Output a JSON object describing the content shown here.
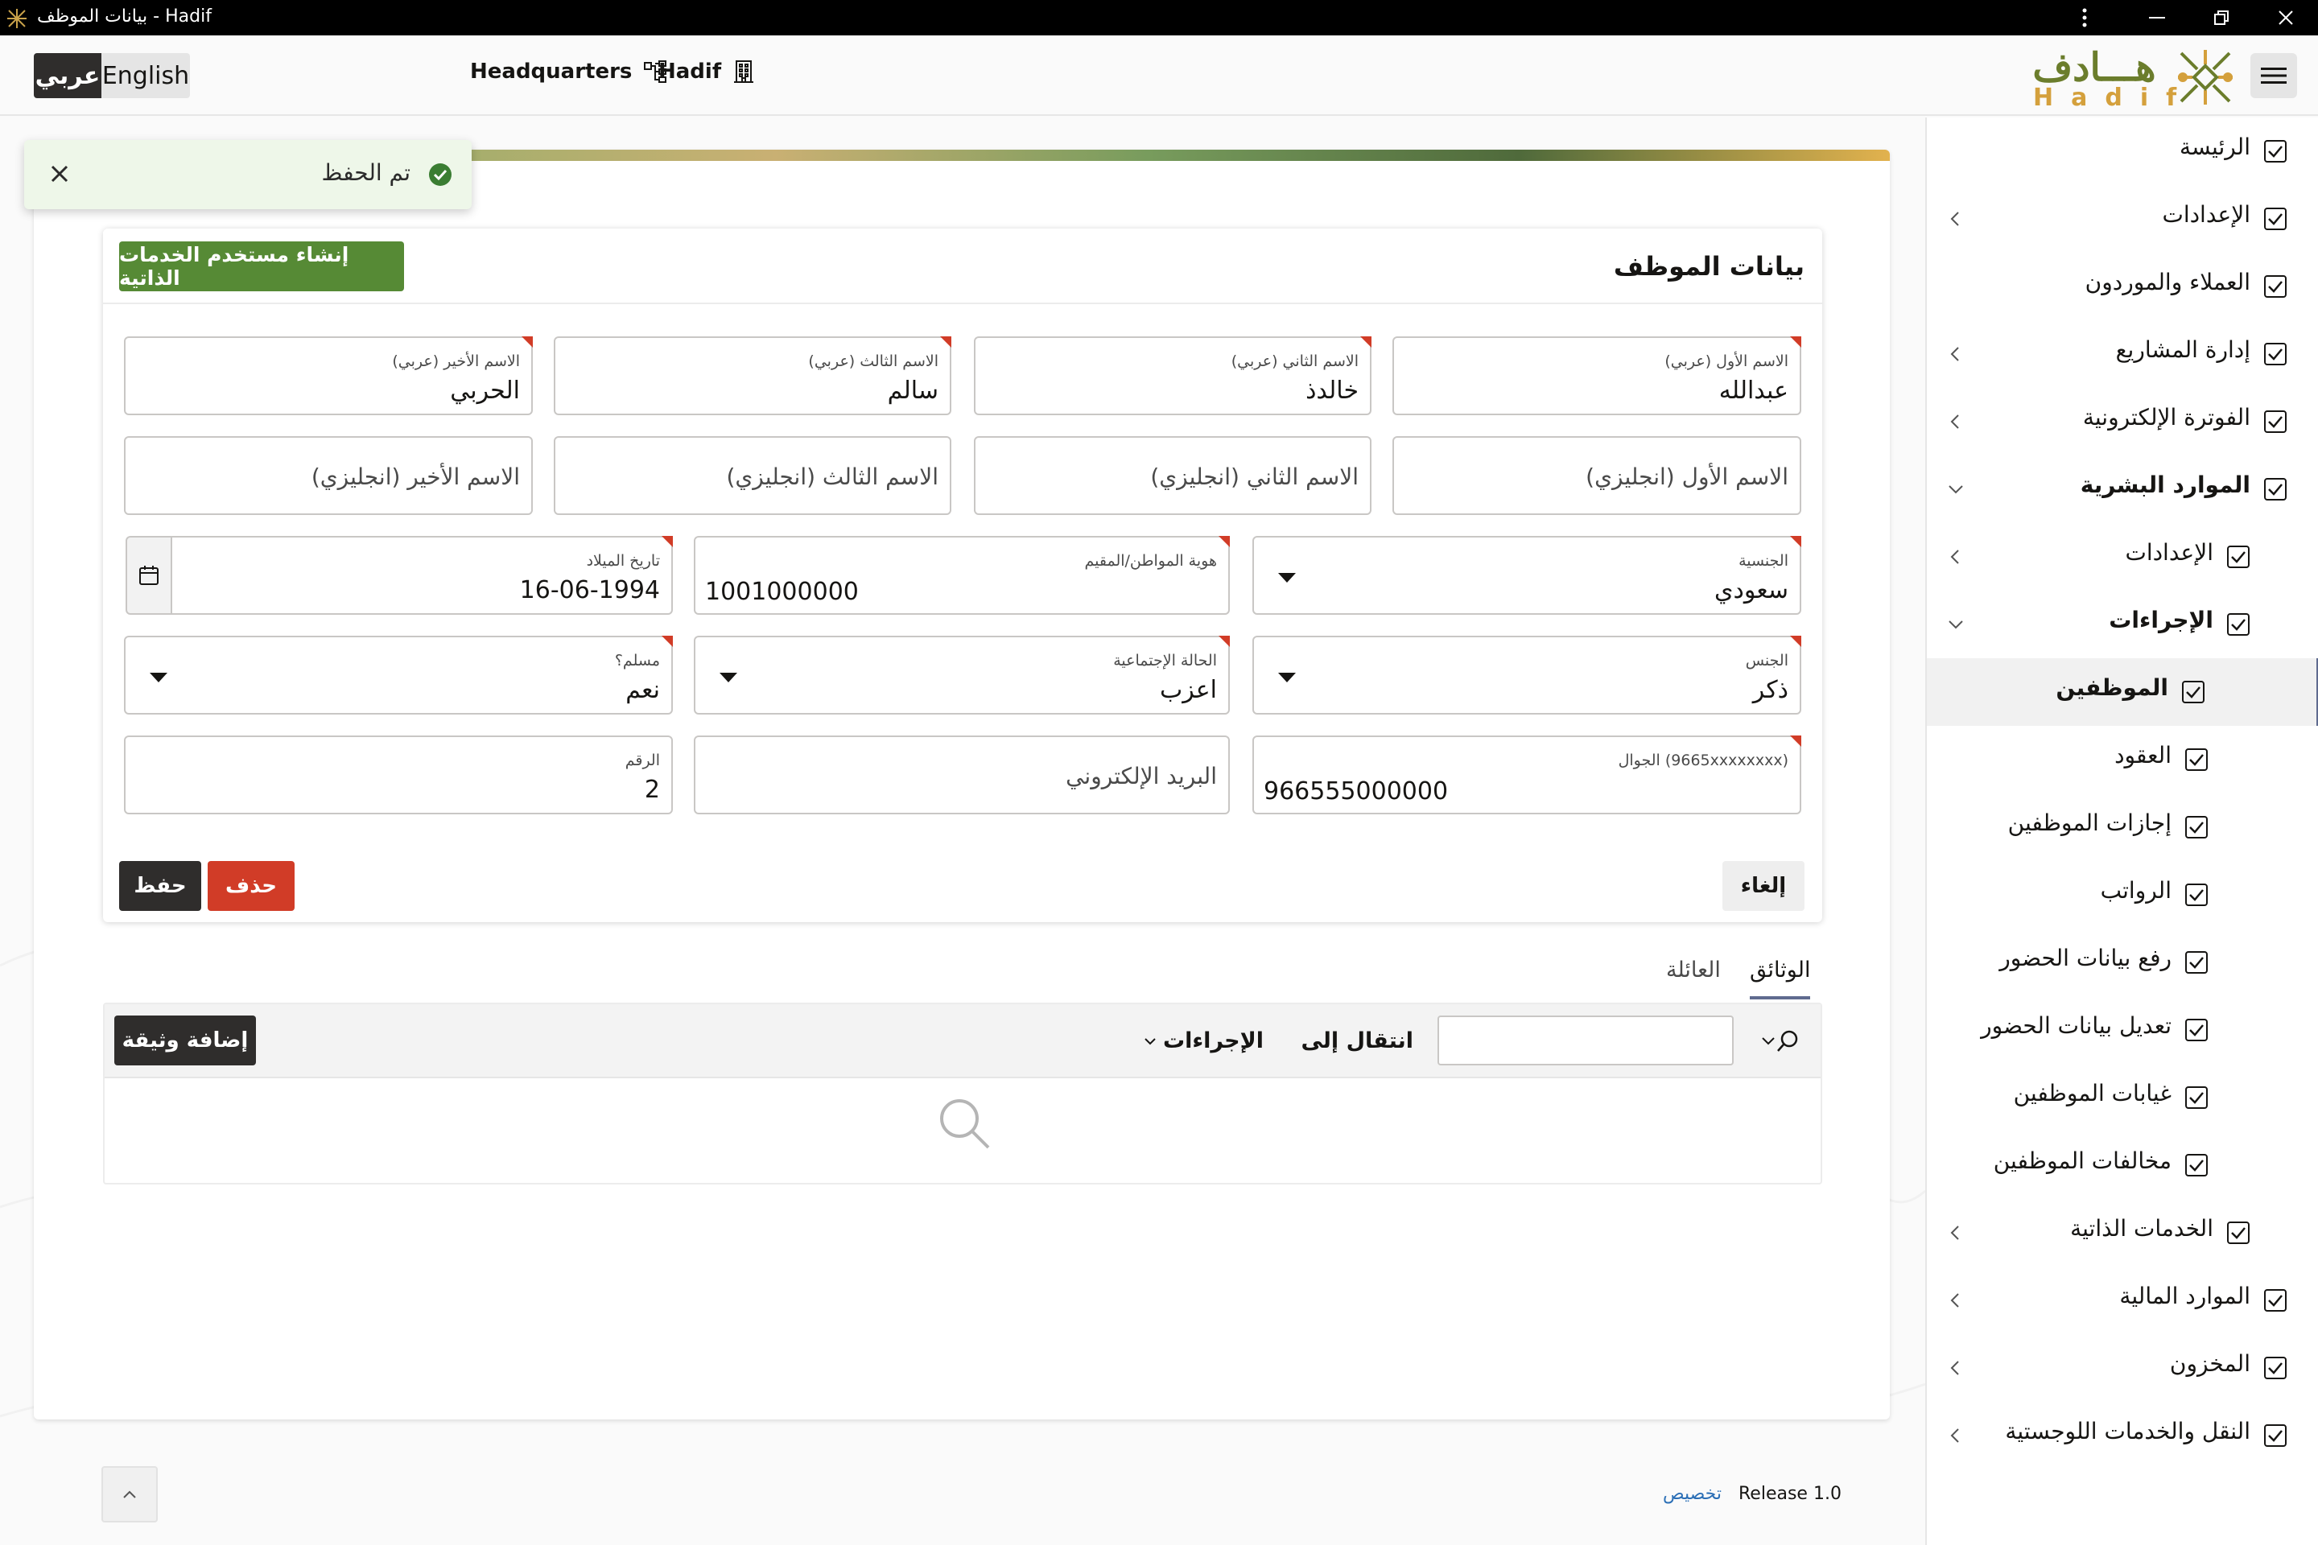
{
  "window": {
    "title": "بيانات الموظف - Hadif"
  },
  "header": {
    "lang_ar": "عربي",
    "lang_en": "English",
    "branch": "Headquarters",
    "company": "Hadif",
    "logo_ar": "هـــادف",
    "logo_en": "Hadif"
  },
  "toast": {
    "message": "تم الحفظ"
  },
  "sidebar": {
    "items": [
      {
        "label": "الرئيسة",
        "bold": false,
        "level": 0,
        "chevron": ""
      },
      {
        "label": "الإعدادات",
        "bold": false,
        "level": 0,
        "chevron": "left"
      },
      {
        "label": "العملاء والموردون",
        "bold": false,
        "level": 0,
        "chevron": ""
      },
      {
        "label": "إدارة المشاريع",
        "bold": false,
        "level": 0,
        "chevron": "left"
      },
      {
        "label": "الفوترة الإلكترونية",
        "bold": false,
        "level": 0,
        "chevron": "left"
      },
      {
        "label": "الموارد البشرية",
        "bold": true,
        "level": 0,
        "chevron": "down"
      },
      {
        "label": "الإعدادات",
        "bold": false,
        "level": 1,
        "chevron": "left"
      },
      {
        "label": "الإجراءات",
        "bold": true,
        "level": 1,
        "chevron": "down"
      },
      {
        "label": "الموظفين",
        "bold": true,
        "level": 2,
        "chevron": "",
        "active": true
      },
      {
        "label": "العقود",
        "bold": false,
        "level": 2,
        "chevron": ""
      },
      {
        "label": "إجازات الموظفين",
        "bold": false,
        "level": 2,
        "chevron": ""
      },
      {
        "label": "الرواتب",
        "bold": false,
        "level": 2,
        "chevron": ""
      },
      {
        "label": "رفع بيانات الحضور",
        "bold": false,
        "level": 2,
        "chevron": ""
      },
      {
        "label": "تعديل بيانات الحضور",
        "bold": false,
        "level": 2,
        "chevron": ""
      },
      {
        "label": "غيابات الموظفين",
        "bold": false,
        "level": 2,
        "chevron": ""
      },
      {
        "label": "مخالفات الموظفين",
        "bold": false,
        "level": 2,
        "chevron": ""
      },
      {
        "label": "الخدمات الذاتية",
        "bold": false,
        "level": 1,
        "chevron": "left"
      },
      {
        "label": "الموارد المالية",
        "bold": false,
        "level": 0,
        "chevron": "left"
      },
      {
        "label": "المخزون",
        "bold": false,
        "level": 0,
        "chevron": "left"
      },
      {
        "label": "النقل والخدمات اللوجستية",
        "bold": false,
        "level": 0,
        "chevron": "left"
      }
    ]
  },
  "card": {
    "title": "بيانات الموظف",
    "self_service_button": "إنشاء مستخدم الخدمات الذاتية",
    "fields": {
      "first_name_ar": {
        "label": "الاسم الأول (عربي)",
        "value": "عبدالله"
      },
      "second_name_ar": {
        "label": "الاسم الثاني (عربي)",
        "value": "خالدذ"
      },
      "third_name_ar": {
        "label": "الاسم الثالث (عربي)",
        "value": "سالم"
      },
      "last_name_ar": {
        "label": "الاسم الأخير (عربي)",
        "value": "الحربي"
      },
      "first_name_en": {
        "placeholder": "الاسم الأول (انجليزي)"
      },
      "second_name_en": {
        "placeholder": "الاسم الثاني (انجليزي)"
      },
      "third_name_en": {
        "placeholder": "الاسم الثالث (انجليزي)"
      },
      "last_name_en": {
        "placeholder": "الاسم الأخير (انجليزي)"
      },
      "nationality": {
        "label": "الجنسية",
        "value": "سعودي"
      },
      "national_id": {
        "label": "هوية المواطن/المقيم",
        "value": "1001000000"
      },
      "birth_date": {
        "label": "تاريخ الميلاد",
        "value": "16-06-1994"
      },
      "gender": {
        "label": "الجنس",
        "value": "ذكر"
      },
      "marital_status": {
        "label": "الحالة الإجتماعية",
        "value": "اعزب"
      },
      "muslim": {
        "label": "مسلم؟",
        "value": "نعم"
      },
      "mobile": {
        "label": "الجوال (9665xxxxxxxx)",
        "value": "966555000000"
      },
      "email": {
        "placeholder": "البريد الإلكتروني"
      },
      "number": {
        "label": "الرقم",
        "value": "2"
      }
    },
    "buttons": {
      "save": "حفظ",
      "delete": "حذف",
      "cancel": "إلغاء"
    }
  },
  "tabs": [
    {
      "label": "الوثائق",
      "selected": true
    },
    {
      "label": "العائلة",
      "selected": false
    }
  ],
  "documents": {
    "goto_label": "انتقال إلى",
    "actions_label": "الإجراءات",
    "add_button": "إضافة وثيقة"
  },
  "footer": {
    "release": "Release 1.0",
    "customize": "تخصيص"
  },
  "colors": {
    "accent_green": "#568a35",
    "danger": "#d13c27",
    "dark": "#2f2d2c",
    "logo_olive": "#6b7d2c",
    "logo_gold": "#d4a03c"
  }
}
